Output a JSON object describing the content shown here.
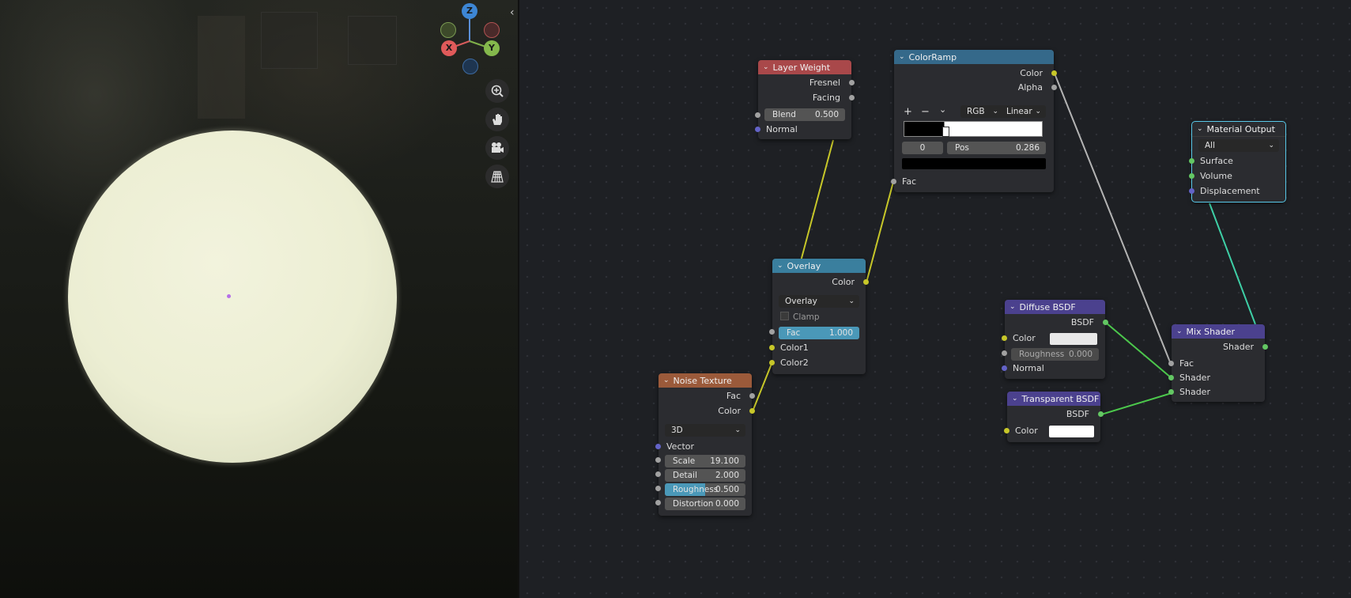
{
  "viewport": {
    "gizmo": {
      "z": "Z",
      "x": "X",
      "y": "Y"
    },
    "nav_icons": [
      "zoom-icon",
      "hand-pan-icon",
      "camera-icon",
      "grid-icon"
    ],
    "collapse": "‹"
  },
  "colors": {
    "header_input": "#a9484a",
    "header_converter": "#3a7f9e",
    "header_color": "#35698a",
    "header_texture": "#9b5a3a",
    "header_shader": "#4b418e",
    "header_output": "#9a2b3a",
    "socket_gray": "#a1a1a1",
    "socket_yellow": "#c7c729",
    "socket_purple": "#6363c7",
    "socket_green": "#63c763",
    "link_yellow": "#c7c729",
    "link_gray": "#b4b4b4",
    "link_green": "#4cc84c",
    "link_teal": "#3ecfa6"
  },
  "nodes": {
    "layer_weight": {
      "title": "Layer Weight",
      "out1": "Fresnel",
      "out2": "Facing",
      "blend_label": "Blend",
      "blend_value": "0.500",
      "normal": "Normal"
    },
    "color_ramp": {
      "title": "ColorRamp",
      "out_color": "Color",
      "out_alpha": "Alpha",
      "add": "+",
      "remove": "−",
      "menu": "⌄",
      "mode": "RGB",
      "interp": "Linear",
      "index": "0",
      "pos_label": "Pos",
      "pos_value": "0.286",
      "in_fac": "Fac"
    },
    "material_output": {
      "title": "Material Output",
      "target": "All",
      "surface": "Surface",
      "volume": "Volume",
      "displacement": "Displacement"
    },
    "overlay": {
      "title": "Overlay",
      "out_color": "Color",
      "blend": "Overlay",
      "clamp": "Clamp",
      "fac_label": "Fac",
      "fac_value": "1.000",
      "fac_fill": 1.0,
      "color1": "Color1",
      "color2": "Color2"
    },
    "noise": {
      "title": "Noise Texture",
      "out_fac": "Fac",
      "out_color": "Color",
      "dim": "3D",
      "vector": "Vector",
      "scale_label": "Scale",
      "scale_value": "19.100",
      "detail_label": "Detail",
      "detail_value": "2.000",
      "rough_label": "Roughness",
      "rough_value": "0.500",
      "rough_fill": 0.5,
      "dist_label": "Distortion",
      "dist_value": "0.000"
    },
    "diffuse": {
      "title": "Diffuse BSDF",
      "out": "BSDF",
      "color": "Color",
      "rough_label": "Roughness",
      "rough_value": "0.000",
      "normal": "Normal"
    },
    "transparent": {
      "title": "Transparent BSDF",
      "out": "BSDF",
      "color": "Color"
    },
    "mix": {
      "title": "Mix Shader",
      "out": "Shader",
      "fac": "Fac",
      "shader1": "Shader",
      "shader2": "Shader"
    }
  }
}
